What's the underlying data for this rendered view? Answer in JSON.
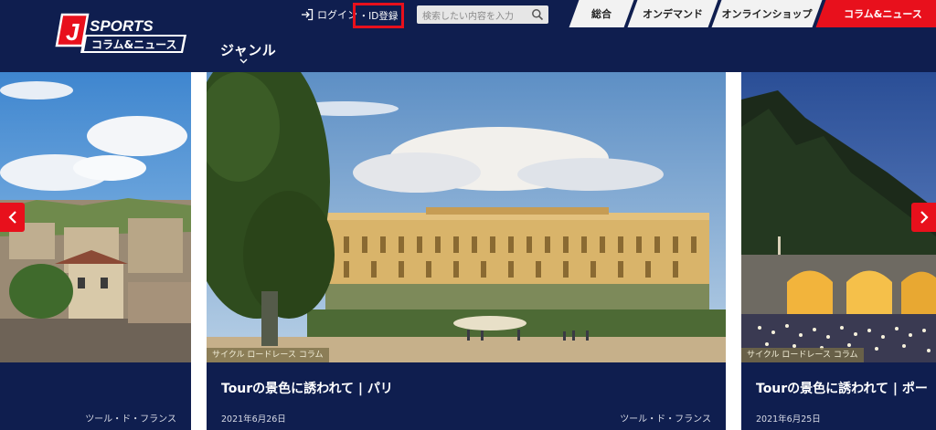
{
  "header": {
    "logo": {
      "brand": "J SPORTS",
      "subtitle": "コラム&ニュース"
    },
    "genre_label": "ジャンル",
    "login_label": "ログイン",
    "id_register_label": "・ID登録",
    "search": {
      "placeholder": "検索したい内容を入力"
    },
    "tabs": [
      {
        "label": "総合",
        "active": false
      },
      {
        "label": "オンデマンド",
        "active": false
      },
      {
        "label": "オンラインショップ",
        "active": false
      },
      {
        "label": "コラム&ニュース",
        "active": true
      }
    ]
  },
  "colors": {
    "navy": "#0f1e4f",
    "accent_red": "#e8101c"
  },
  "carousel": {
    "cards": [
      {
        "position": "left",
        "category": "",
        "title": "",
        "date": "",
        "series": "ツール・ド・フランス"
      },
      {
        "position": "center",
        "category": "サイクル ロードレース コラム",
        "title": "Tourの景色に誘われて | パリ",
        "date": "2021年6月26日",
        "series": "ツール・ド・フランス"
      },
      {
        "position": "right",
        "category": "サイクル ロードレース コラム",
        "title": "Tourの景色に誘われて | ポー",
        "date": "2021年6月25日",
        "series": ""
      }
    ],
    "prev_icon": "chevron-left-icon",
    "next_icon": "chevron-right-icon"
  }
}
